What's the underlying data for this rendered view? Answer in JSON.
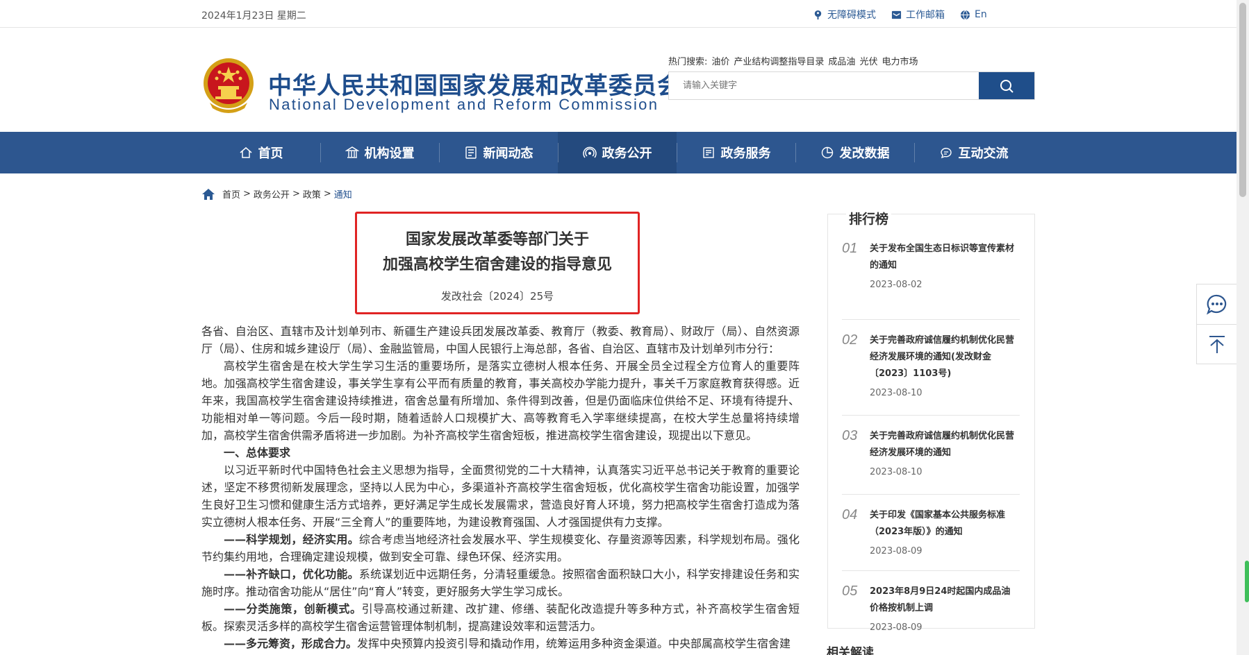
{
  "topbar": {
    "date": "2024年1月23日 星期二",
    "links": [
      {
        "label": "无障碍模式",
        "icon": "accessibility-icon"
      },
      {
        "label": "工作邮箱",
        "icon": "mail-icon"
      },
      {
        "label": "En",
        "icon": "globe-icon"
      }
    ]
  },
  "header": {
    "logo_cn": "中华人民共和国国家发展和改革委员会",
    "logo_en": "National Development and Reform Commission",
    "hot_label": "热门搜索:",
    "hot_items": [
      "油价",
      "产业结构调整指导目录",
      "成品油",
      "光伏",
      "电力市场"
    ],
    "search_placeholder": "请输入关键字"
  },
  "nav": {
    "items": [
      {
        "label": "首页",
        "icon": "home-icon"
      },
      {
        "label": "机构设置",
        "icon": "building-icon"
      },
      {
        "label": "新闻动态",
        "icon": "news-icon"
      },
      {
        "label": "政务公开",
        "icon": "broadcast-icon"
      },
      {
        "label": "政务服务",
        "icon": "service-icon"
      },
      {
        "label": "发改数据",
        "icon": "pie-chart-icon"
      },
      {
        "label": "互动交流",
        "icon": "chat-icon"
      }
    ],
    "active_index": 3
  },
  "breadcrumb": {
    "items": [
      "首页",
      "政务公开",
      "政策",
      "通知"
    ],
    "separator": ">"
  },
  "article": {
    "title_line1": "国家发展改革委等部门关于",
    "title_line2": "加强高校学生宿舍建设的指导意见",
    "doc_number": "发改社会〔2024〕25号",
    "recipients": "各省、自治区、直辖市及计划单列市、新疆生产建设兵团发展改革委、教育厅（教委、教育局）、财政厅（局）、自然资源厅（局）、住房和城乡建设厅（局）、金融监管局，中国人民银行上海总部，各省、自治区、直辖市及计划单列市分行：",
    "intro": "高校学生宿舍是在校大学生学习生活的重要场所，是落实立德树人根本任务、开展全员全过程全方位育人的重要阵地。加强高校学生宿舍建设，事关学生享有公平而有质量的教育，事关高校办学能力提升，事关千万家庭教育获得感。近年来，我国高校学生宿舍建设持续推进，宿舍总量有所增加、条件得到改善，但是仍面临床位供给不足、环境有待提升、功能相对单一等问题。今后一段时期，随着适龄人口规模扩大、高等教育毛入学率继续提高，在校大学生总量将持续增加，高校学生宿舍供需矛盾将进一步加剧。为补齐高校学生宿舍短板，推进高校学生宿舍建设，现提出以下意见。",
    "section1": "一、总体要求",
    "section1_body": "以习近平新时代中国特色社会主义思想为指导，全面贯彻党的二十大精神，认真落实习近平总书记关于教育的重要论述，坚定不移贯彻新发展理念，坚持以人民为中心，多渠道补齐高校学生宿舍短板，优化高校学生宿舍功能设置，加强学生良好卫生习惯和健康生活方式培养，更好满足学生成长发展需求，营造良好育人环境，努力把高校学生宿舍打造成为落实立德树人根本任务、开展“三全育人”的重要阵地，为建设教育强国、人才强国提供有力支撑。",
    "p1_head": "——科学规划，经济实用。",
    "p1_body": "综合考虑当地经济社会发展水平、学生规模变化、存量资源等因素，科学规划布局。强化节约集约用地，合理确定建设规模，做到安全可靠、绿色环保、经济实用。",
    "p2_head": "——补齐缺口，优化功能。",
    "p2_body": "系统谋划近中远期任务，分清轻重缓急。按照宿舍面积缺口大小，科学安排建设任务和实施时序。推动宿舍功能从“居住”向“育人”转变，更好服务大学生学习成长。",
    "p3_head": "——分类施策，创新模式。",
    "p3_body": "引导高校通过新建、改扩建、修缮、装配化改造提升等多种方式，补齐高校学生宿舍短板。探索灵活多样的高校学生宿舍运营管理体制机制，提高建设效率和运营活力。",
    "p4_head": "——多元筹资，形成合力。",
    "p4_body": "发挥中央预算内投资引导和撬动作用，统筹运用多种资金渠道。中央部属高校学生宿舍建"
  },
  "ranking": {
    "title": "排行榜",
    "items": [
      {
        "num": "01",
        "text": "关于发布全国生态日标识等宣传素材的通知",
        "date": "2023-08-02"
      },
      {
        "num": "02",
        "text": "关于完善政府诚信履约机制优化民营经济发展环境的通知(发改财金〔2023〕1103号)",
        "date": "2023-08-10"
      },
      {
        "num": "03",
        "text": "关于完善政府诚信履约机制优化民营经济发展环境的通知",
        "date": "2023-08-10"
      },
      {
        "num": "04",
        "text": "关于印发《国家基本公共服务标准（2023年版）》的通知",
        "date": "2023-08-09"
      },
      {
        "num": "05",
        "text": "2023年8月9日24时起国内成品油价格按机制上调",
        "date": "2023-08-09"
      }
    ]
  },
  "related_title": "相关解读",
  "floatbar": {
    "items": [
      "chat-bubble-icon",
      "back-to-top-icon"
    ]
  }
}
